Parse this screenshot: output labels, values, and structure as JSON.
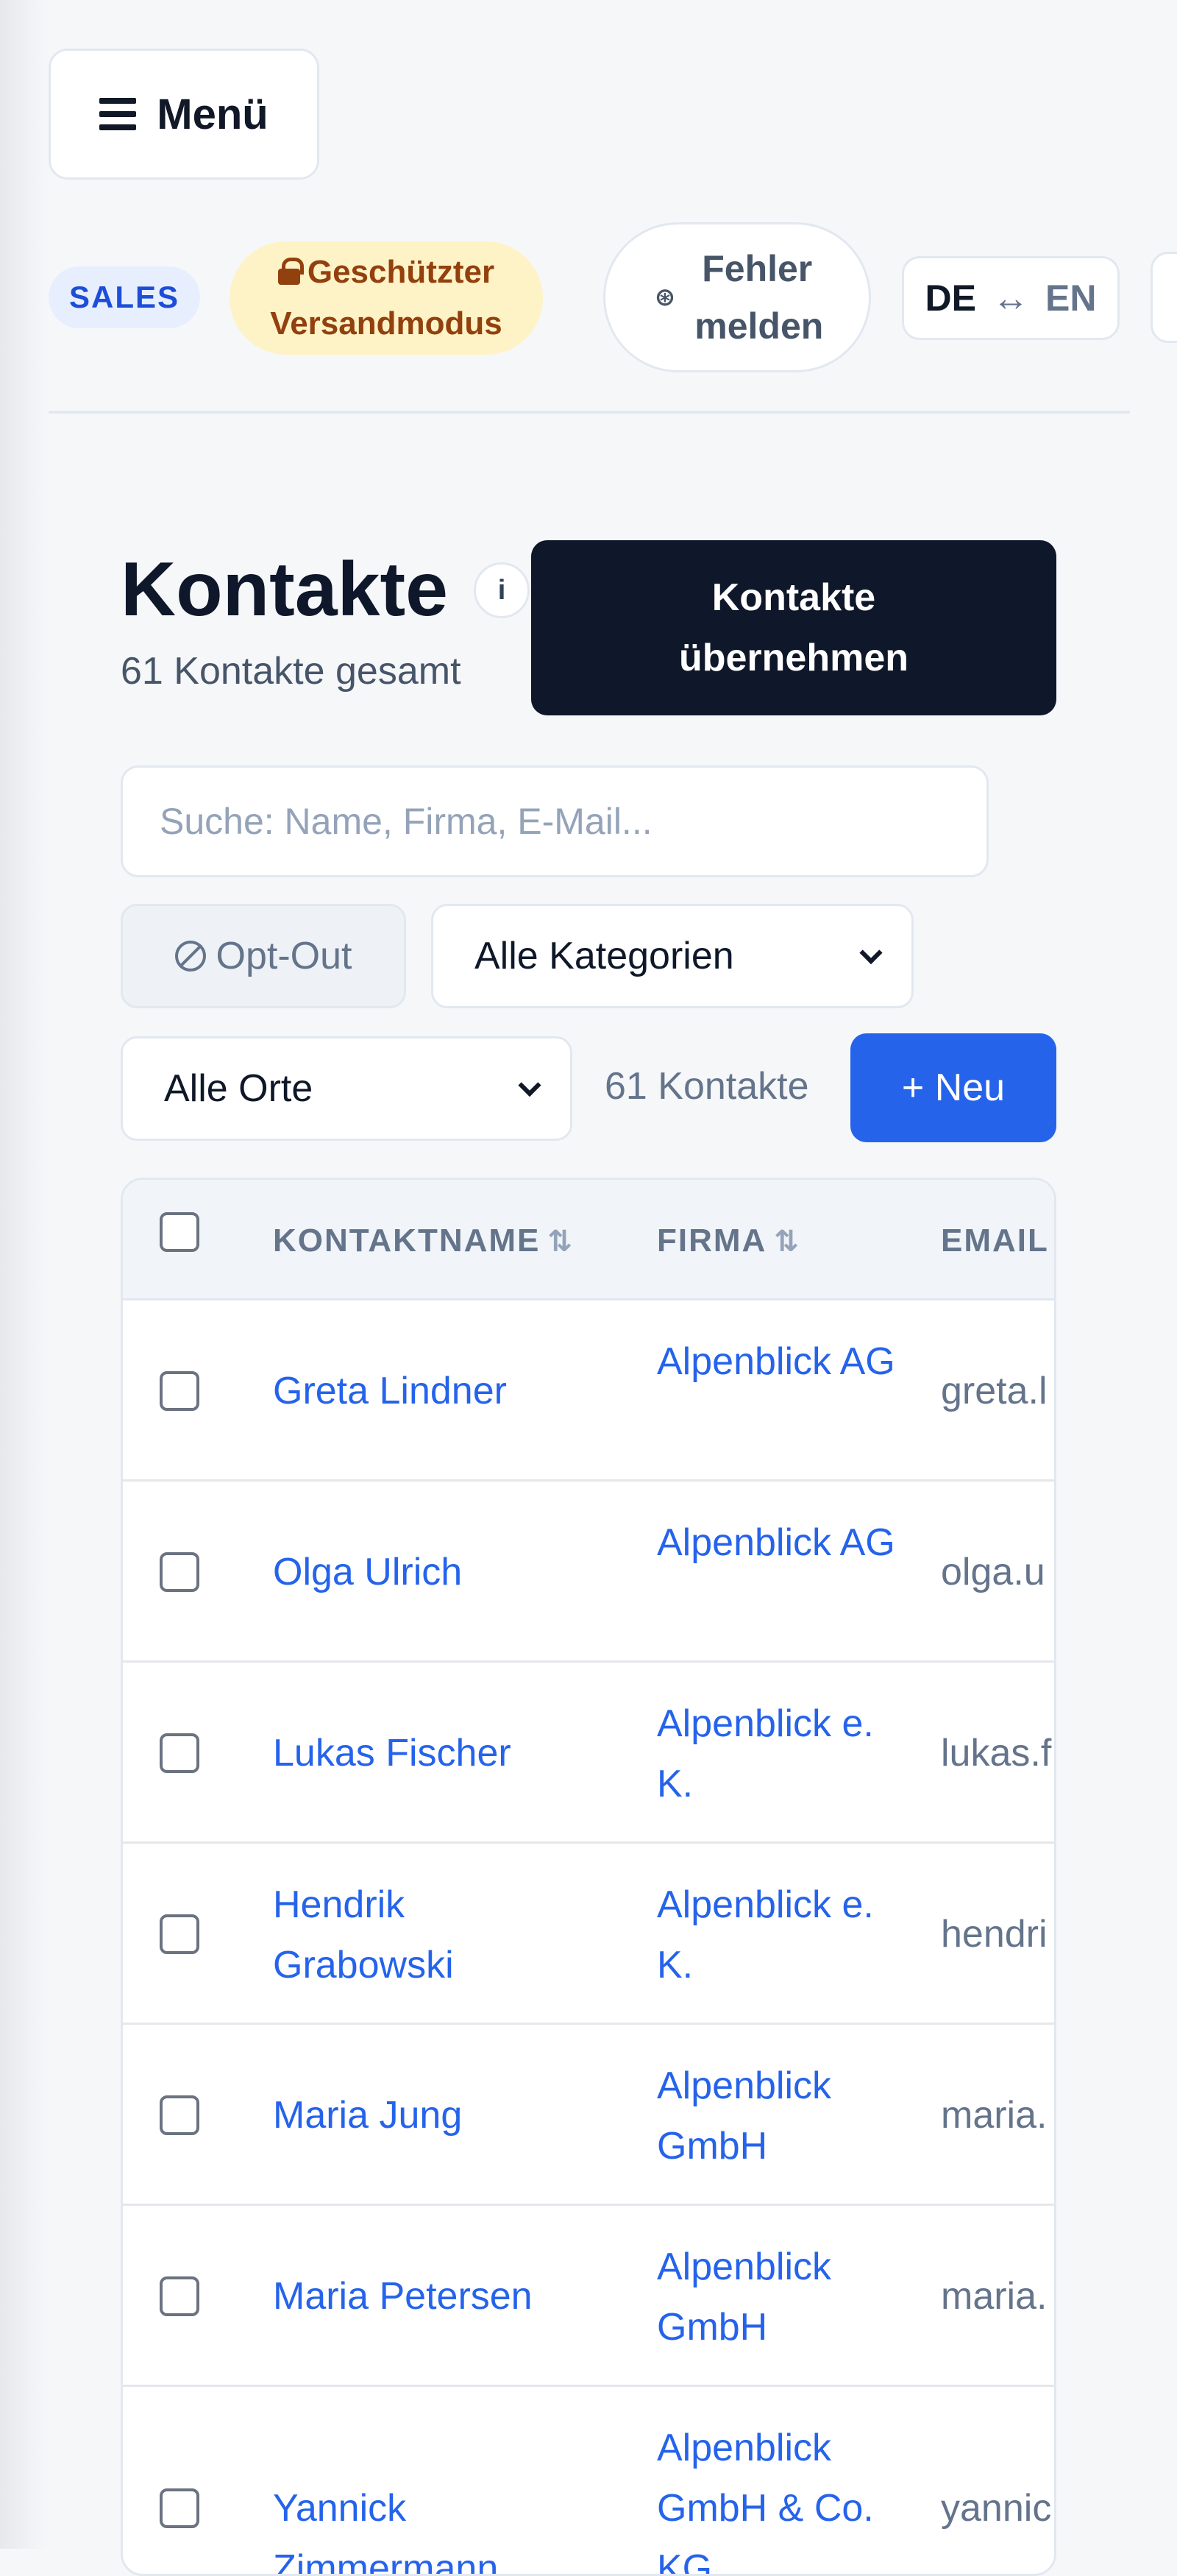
{
  "header": {
    "menu_label": "Menü",
    "role_badge": "SALES",
    "protected_mode": "Geschützter Versandmodus",
    "report_label": "Fehler melden",
    "lang_from": "DE",
    "lang_arrow": "↔",
    "lang_to": "EN"
  },
  "page": {
    "title": "Kontakte",
    "info": "i",
    "subtitle": "61 Kontakte gesamt",
    "import_button": "Kontakte übernehmen"
  },
  "filters": {
    "search_placeholder": "Suche: Name, Firma, E-Mail...",
    "optout_label": "Opt-Out",
    "category_selected": "Alle Kategorien",
    "city_selected": "Alle Orte",
    "count_label": "61 Kontakte",
    "new_button": "+ Neu"
  },
  "table": {
    "columns": [
      "KONTAKTNAME",
      "FIRMA",
      "EMAIL"
    ],
    "sort_icon": "⇅",
    "rows": [
      {
        "name": "Greta Lindner",
        "company": "Alpenblick AG",
        "email": "greta.l"
      },
      {
        "name": "Olga Ulrich",
        "company": "Alpenblick AG",
        "email": "olga.u"
      },
      {
        "name": "Lukas Fischer",
        "company": "Alpenblick e. K.",
        "email": "lukas.f"
      },
      {
        "name": "Hendrik Grabowski",
        "company": "Alpenblick e. K.",
        "email": "hendri"
      },
      {
        "name": "Maria Jung",
        "company": "Alpenblick GmbH",
        "email": "maria."
      },
      {
        "name": "Maria Petersen",
        "company": "Alpenblick GmbH",
        "email": "maria."
      },
      {
        "name": "Yannick Zimmermann",
        "company": "Alpenblick GmbH & Co. KG",
        "email": "yannic"
      }
    ]
  }
}
